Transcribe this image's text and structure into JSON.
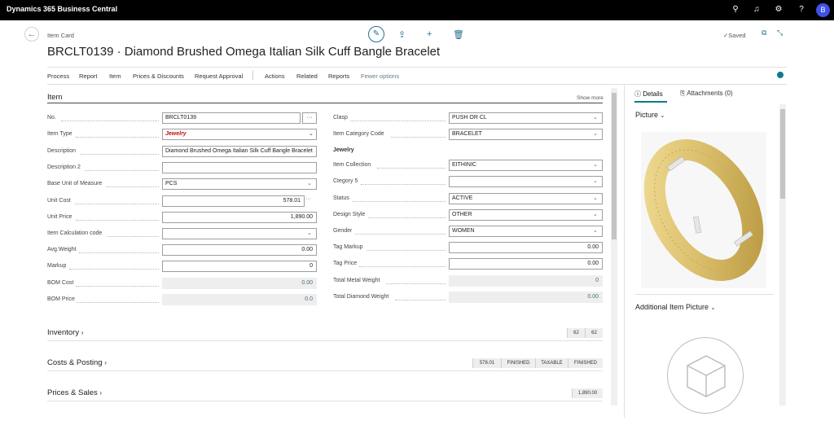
{
  "topbar": {
    "brand": "Dynamics 365 Business Central",
    "avatar": "B",
    "icons": [
      "search-icon",
      "bell-icon",
      "settings-icon",
      "help-icon"
    ]
  },
  "page": {
    "breadcrumb": "Item Card",
    "title": "BRCLT0139 · Diamond Brushed Omega Italian Silk Cuff Bangle Bracelet",
    "saved": "Saved"
  },
  "menu": [
    "Process",
    "Report",
    "Item",
    "Prices & Discounts",
    "Request Approval",
    "Actions",
    "Related",
    "Reports",
    "Fewer options"
  ],
  "item_section": {
    "title": "Item",
    "show_more": "Show more"
  },
  "left_fields": [
    {
      "label": "No.",
      "value": "BRCLT0139"
    },
    {
      "label": "Item Type",
      "value": "Jewelry"
    },
    {
      "label": "Description",
      "value": "Diamond Brushed Omega Italian Silk Cuff Bangle Bracelet"
    },
    {
      "label": "Description 2",
      "value": ""
    },
    {
      "label": "Base Unit of Measure",
      "value": "PCS"
    },
    {
      "label": "Unit Cost",
      "value": "578.01"
    },
    {
      "label": "Unit Price",
      "value": "1,890.00"
    },
    {
      "label": "Item Calculation code",
      "value": ""
    },
    {
      "label": "Avg.Weight",
      "value": "0.00"
    },
    {
      "label": "Markup",
      "value": "0"
    },
    {
      "label": "BOM Cost",
      "value": "0.00"
    },
    {
      "label": "BOM Price",
      "value": "0.0"
    }
  ],
  "right_fields": [
    {
      "label": "Clasp",
      "value": "PUSH OR CL"
    },
    {
      "label": "Item Category Code",
      "value": "BRACELET"
    },
    {
      "label": "Item Collection",
      "value": "EITHINIC"
    },
    {
      "label": "Ctegory 5",
      "value": ""
    },
    {
      "label": "Status",
      "value": "ACTIVE"
    },
    {
      "label": "Design Style",
      "value": "OTHER"
    },
    {
      "label": "Gender",
      "value": "WOMEN"
    },
    {
      "label": "Tag Markup",
      "value": "0.00"
    },
    {
      "label": "Tag Price",
      "value": "0.00"
    },
    {
      "label": "Total Metal Weight",
      "value": "0"
    },
    {
      "label": "Total Diamond Weight",
      "value": "0.00"
    }
  ],
  "jewelry_subheading": "Jewelry",
  "fasttabs": [
    {
      "title": "Inventory",
      "badges": [
        "62",
        "62"
      ]
    },
    {
      "title": "Costs & Posting",
      "badges": [
        "578.01",
        "FINISHED",
        "TAXABLE",
        "FINISHED"
      ]
    },
    {
      "title": "Prices & Sales",
      "badges": [
        "1,890.00"
      ]
    }
  ],
  "factbox": {
    "tabs": [
      "Details",
      "Attachments (0)"
    ],
    "picture_title": "Picture",
    "additional_title": "Additional Item Picture"
  },
  "colors": {
    "accent": "#0f7a8a",
    "link": "#2a6f8f",
    "required": "#c01010",
    "gold": "#d9bd6a"
  }
}
